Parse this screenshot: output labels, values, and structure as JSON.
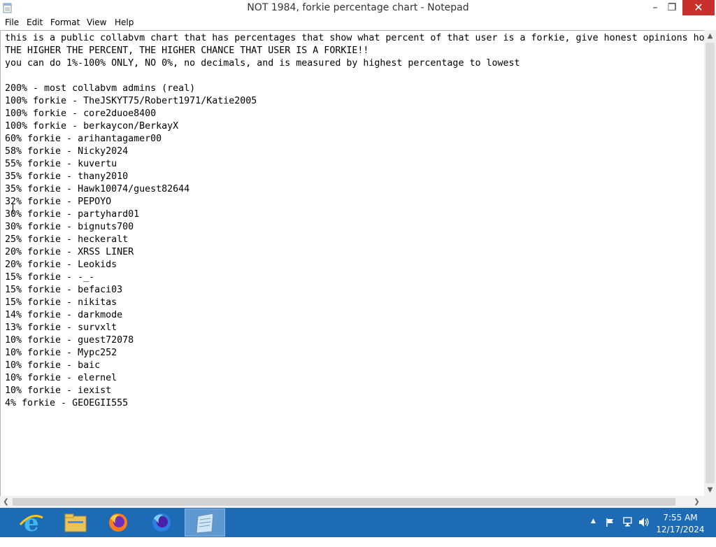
{
  "window": {
    "title": "NOT 1984, forkie percentage chart - Notepad",
    "minimize_label": "–",
    "restore_label": "❐",
    "close_label": "✕"
  },
  "menu": {
    "file": "File",
    "edit": "Edit",
    "format": "Format",
    "view": "View",
    "help": "Help"
  },
  "document": {
    "text": "this is a public collabvm chart that has percentages that show what percent of that user is a forkie, give honest opinions ho\nTHE HIGHER THE PERCENT, THE HIGHER CHANCE THAT USER IS A FORKIE!!\nyou can do 1%-100% ONLY, NO 0%, no decimals, and is measured by highest percentage to lowest\n\n200% - most collabvm admins (real)\n100% forkie - TheJSKYT75/Robert1971/Katie2005\n100% forkie - core2duoe8400\n100% forkie - berkaycon/BerkayX\n60% forkie - arihantagamer00\n58% forkie - Nicky2024\n55% forkie - kuvertu\n35% forkie - thany2010\n35% forkie - Hawk10074/guest82644\n32% forkie - PEPOYO\n30% forkie - partyhard01\n30% forkie - bignuts700\n25% forkie - heckeralt\n20% forkie - XRSS LINER\n20% forkie - Leokids\n15% forkie - -_-\n15% forkie - befaci03\n15% forkie - nikitas\n14% forkie - darkmode\n13% forkie - survxlt\n10% forkie - guest72078\n10% forkie - Mypc252\n10% forkie - baic\n10% forkie - elernel\n10% forkie - iexist\n4% forkie - GEOEGII555"
  },
  "scrollbars": {
    "up": "▲",
    "down": "▼",
    "left": "❮",
    "right": "❯"
  },
  "taskbar": {
    "items": [
      {
        "icon": "internet-explorer-icon"
      },
      {
        "icon": "file-explorer-icon"
      },
      {
        "icon": "firefox-icon"
      },
      {
        "icon": "firefox-developer-icon"
      },
      {
        "icon": "notepad-icon",
        "active": true
      }
    ],
    "tray_chevron": "▲",
    "time": "7:55 AM",
    "date": "12/17/2024"
  },
  "colors": {
    "taskbar": "#1d6bb5",
    "close_button": "#c7302b",
    "active_task": "#5f99d2"
  }
}
